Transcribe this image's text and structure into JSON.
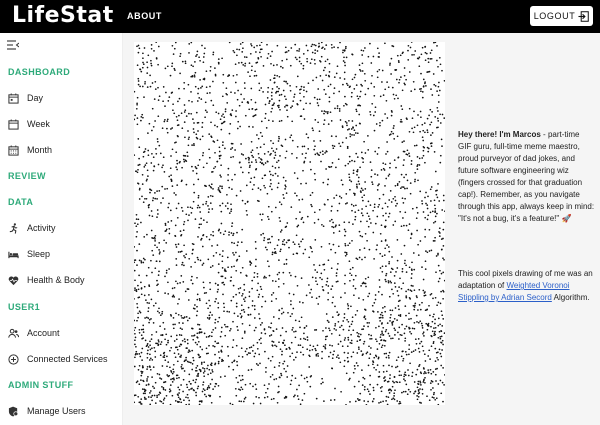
{
  "header": {
    "logo": "LifeStat",
    "about_label": "ABOUT",
    "logout_label": "LOGOUT",
    "logout_icon": "logout-arrow-icon"
  },
  "sidebar": {
    "collapse_icon": "menu-collapse-icon",
    "sections": {
      "dashboard": "DASHBOARD",
      "review": "REVIEW",
      "data": "DATA",
      "user": "USER1",
      "admin": "ADMIN STUFF"
    },
    "items": [
      {
        "label": "Day",
        "icon": "calendar-icon"
      },
      {
        "label": "Week",
        "icon": "calendar-icon"
      },
      {
        "label": "Month",
        "icon": "calendar-grid-icon"
      },
      {
        "label": "Activity",
        "icon": "running-person-icon"
      },
      {
        "label": "Sleep",
        "icon": "bed-icon"
      },
      {
        "label": "Health & Body",
        "icon": "heart-icon"
      },
      {
        "label": "Account",
        "icon": "account-group-icon"
      },
      {
        "label": "Connected Services",
        "icon": "add-circle-icon"
      },
      {
        "label": "Manage Users",
        "icon": "admin-shield-icon"
      }
    ],
    "accent_color": "#2eaa7a"
  },
  "main": {
    "portrait_alt": "stippled portrait drawing",
    "intro_bold": "Hey there! I'm Marcos",
    "intro_text": " - part-time GIF guru, full-time meme maestro, proud purveyor of dad jokes, and future software engineering wiz (fingers crossed for that graduation cap!). Remember, as you navigate through this app, always keep in mind: \"It's not a bug, it's a feature!\" 🚀",
    "credit_prefix": "This cool pixels drawing of me was an adaptation of ",
    "credit_link": "Weighted Voronoi Stippling by Adrian Secord",
    "credit_suffix": " Algorithm.",
    "link_color": "#2b5fc9"
  }
}
